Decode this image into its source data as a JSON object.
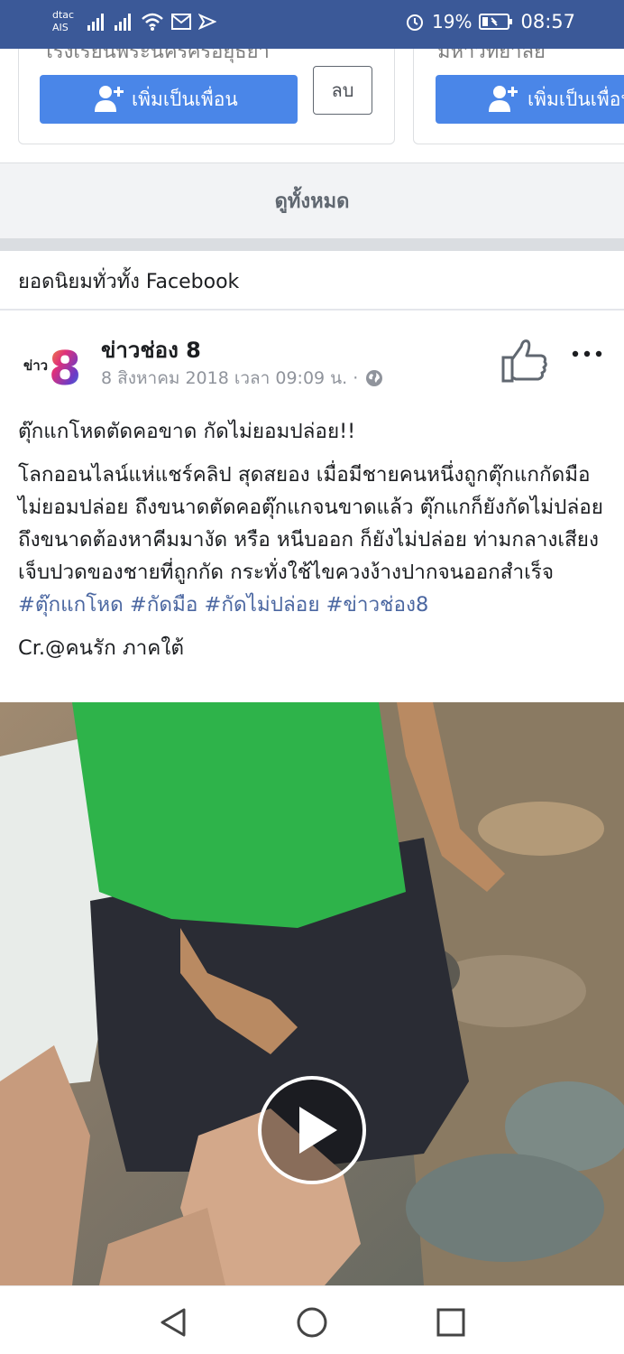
{
  "status_bar": {
    "carrier_line1": "dtac",
    "carrier_line2": "AIS",
    "battery": "19%",
    "time": "08:57",
    "color": "#3b5998"
  },
  "suggestions": {
    "cards": [
      {
        "name": "โรงเรียนพระนครศรีอยุธยา",
        "add_label": "เพิ่มเป็นเพื่อน",
        "remove_label": "ลบ"
      },
      {
        "name": "มหาวิทยาลัย",
        "add_label": "เพิ่มเป็นเพื่อน"
      }
    ],
    "see_all": "ดูทั้งหมด"
  },
  "section": {
    "title": "ยอดนิยมทั่วทั้ง Facebook"
  },
  "post": {
    "page_name": "ข่าวช่อง 8",
    "logo_text": "ข่าว",
    "logo_number": "8",
    "meta": "8 สิงหาคม 2018 เวลา 09:09 น. ·",
    "headline": "ตุ๊กแกโหดตัดคอขาด กัดไม่ยอมปล่อย!!",
    "body": "โลกออนไลน์แห่แชร์คลิป สุดสยอง เมื่อมีชายคนหนึ่งถูกตุ๊กแกกัดมือไม่ยอมปล่อย ถึงขนาดตัดคอตุ๊กแกจนขาดแล้ว ตุ๊กแกก็ยังกัดไม่ปล่อย ถึงขนาดต้องหาคีมมางัด หรือ หนีบออก ก็ยังไม่ปล่อย ท่ามกลางเสียงเจ็บปวดของชายที่ถูกกัด กระทั่งใช้ไขควงง้างปากจนออกสำเร็จ",
    "hashtags": [
      "#ตุ๊กแกโหด",
      "#กัดมือ",
      "#กัดไม่ปล่อย",
      "#ข่าวช่อง8"
    ],
    "credit": "Cr.@คนรัก ภาคใต้",
    "hashtag_color": "#4b67a1"
  },
  "icons": {
    "like": "thumbs-up-icon",
    "more": "more-dots-icon",
    "globe": "globe-icon",
    "play": "play-icon",
    "back": "back-triangle-icon",
    "home": "home-circle-icon",
    "recents": "recents-square-icon"
  }
}
